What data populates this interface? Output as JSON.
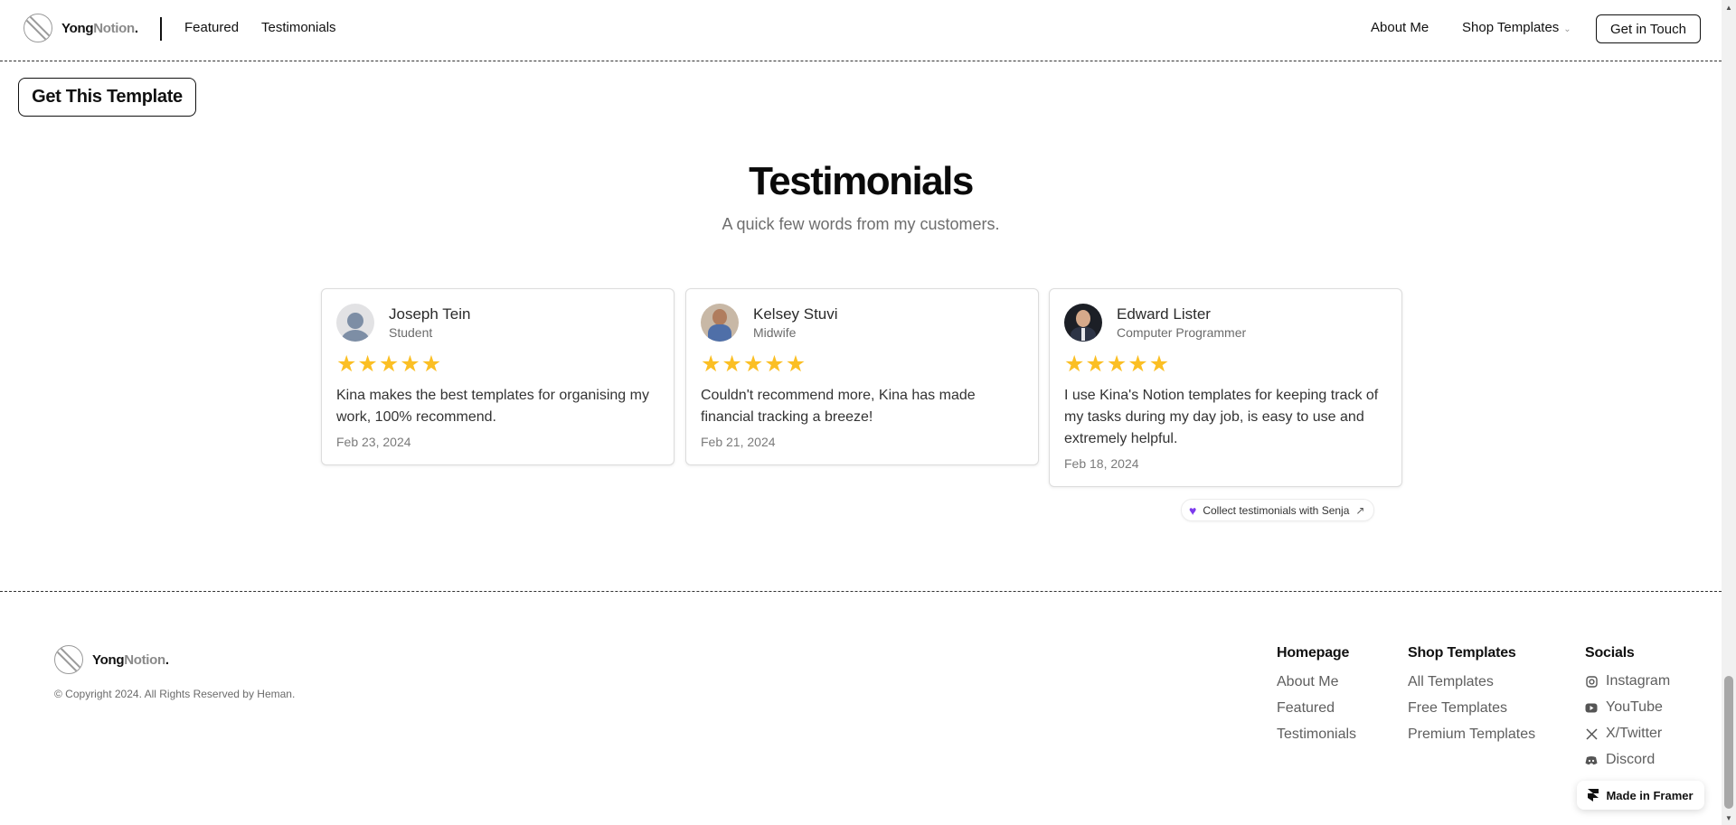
{
  "header": {
    "logo": {
      "brand_bold": "Yong",
      "brand_light": "Notion",
      "dot": "."
    },
    "nav": {
      "featured": "Featured",
      "testimonials": "Testimonials",
      "about": "About Me",
      "shop": "Shop Templates"
    },
    "cta": "Get in Touch"
  },
  "get_template_label": "Get This Template",
  "testimonials": {
    "title": "Testimonials",
    "subtitle": "A quick few words from my customers.",
    "cards": [
      {
        "name": "Joseph Tein",
        "role": "Student",
        "rating": 5,
        "quote": "Kina makes the best templates for organising my work, 100% recommend.",
        "date": "Feb 23, 2024"
      },
      {
        "name": "Kelsey Stuvi",
        "role": "Midwife",
        "rating": 5,
        "quote": "Couldn't recommend more, Kina has made financial tracking a breeze!",
        "date": "Feb 21, 2024"
      },
      {
        "name": "Edward Lister",
        "role": "Computer Programmer",
        "rating": 5,
        "quote": "I use Kina's Notion templates for keeping track of my tasks during my day job, is easy to use and extremely helpful.",
        "date": "Feb 18, 2024"
      }
    ],
    "senja_label": "Collect testimonials with Senja"
  },
  "footer": {
    "copyright": "© Copyright 2024. All Rights Reserved by Heman.",
    "columns": [
      {
        "heading": "Homepage",
        "links": [
          "About Me",
          "Featured",
          "Testimonials"
        ]
      },
      {
        "heading": "Shop Templates",
        "links": [
          "All Templates",
          "Free Templates",
          "Premium Templates"
        ]
      },
      {
        "heading": "Socials",
        "links": [
          "Instagram",
          "YouTube",
          "X/Twitter",
          "Discord"
        ]
      }
    ],
    "social_icons": [
      "instagram-icon",
      "youtube-icon",
      "x-twitter-icon",
      "discord-icon"
    ]
  },
  "framer_badge": "Made in Framer",
  "colors": {
    "star": "#fbbf24",
    "senja_heart": "#7c3aed",
    "text": "#111111",
    "muted": "#6e6e6e"
  }
}
